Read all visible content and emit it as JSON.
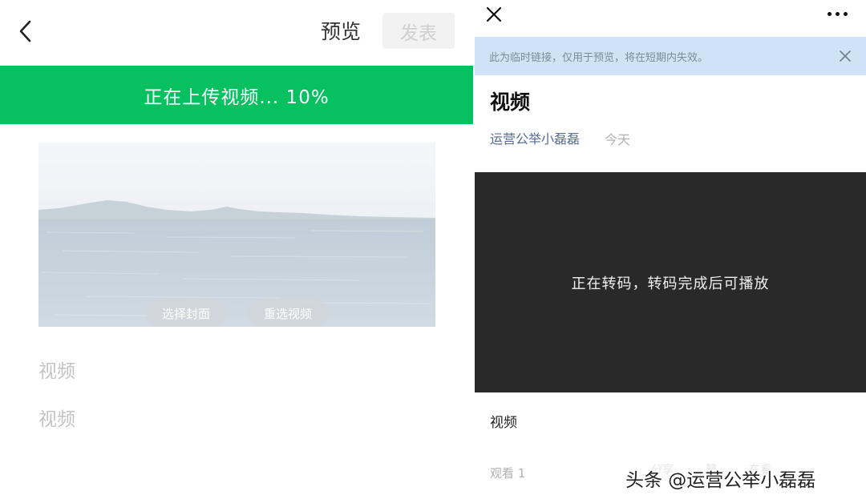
{
  "editor": {
    "preview_label": "预览",
    "publish_label": "发表",
    "upload_status": "正在上传视频... 10%",
    "cover_button": "选择封面",
    "reselect_button": "重选视频",
    "title_value": "视频",
    "description_value": "视频"
  },
  "preview": {
    "notice": "此为临时链接，仅用于预览，将在短期内失效。",
    "article_title": "视频",
    "author": "运营公举小磊磊",
    "date": "今天",
    "player_message": "正在转码，转码完成后可播放",
    "caption": "视频",
    "views": "观看 1",
    "faint_actions": [
      "分享",
      "赞",
      "在看"
    ]
  },
  "watermark": "头条 @运营公举小磊磊",
  "colors": {
    "accent_green": "#07c160",
    "link_blue": "#576b95",
    "notice_bg": "#cfe3f7",
    "player_bg": "#292929"
  },
  "icons": {
    "back": "chevron-left-icon",
    "close": "close-icon",
    "more": "more-dots-icon",
    "notice_close": "close-icon"
  }
}
